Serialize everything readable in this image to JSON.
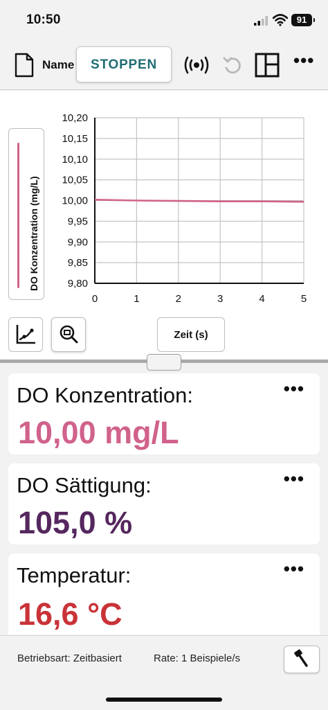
{
  "status_bar": {
    "time": "10:50",
    "battery": "91"
  },
  "toolbar": {
    "name_label": "Name",
    "stop_label": "STOPPEN",
    "icons": [
      "document-icon",
      "sensor-broadcast-icon",
      "undo-icon",
      "layout-icon",
      "more-icon"
    ]
  },
  "chart": {
    "ylabel": "DO Konzentration (mg/L)",
    "xlabel": "Zeit (s)",
    "tool_icons": [
      "graph-fit-icon",
      "zoom-fit-icon"
    ]
  },
  "chart_data": {
    "type": "line",
    "title": "",
    "xlabel": "Zeit (s)",
    "ylabel": "DO Konzentration (mg/L)",
    "xlim": [
      0,
      5
    ],
    "ylim": [
      9.8,
      10.2
    ],
    "x_ticks": [
      "0",
      "1",
      "2",
      "3",
      "4",
      "5"
    ],
    "y_ticks": [
      "10,20",
      "10,15",
      "10,10",
      "10,05",
      "10,00",
      "9,95",
      "9,90",
      "9,85",
      "9,80"
    ],
    "grid": true,
    "series": [
      {
        "color": "#d0628b",
        "x": [
          0,
          1,
          2,
          3,
          4,
          5
        ],
        "y": [
          10.002,
          10.0,
          9.999,
          9.998,
          9.998,
          9.997
        ]
      }
    ]
  },
  "meters": [
    {
      "label": "DO Konzentration:",
      "value": "10,00 mg/L",
      "color": "#d0628b"
    },
    {
      "label": "DO Sättigung:",
      "value": "105,0 %",
      "color": "#55275e"
    },
    {
      "label": "Temperatur:",
      "value": "16,6 °C",
      "color": "#c93338"
    }
  ],
  "footer": {
    "mode": "Betriebsart: Zeitbasiert",
    "rate": "Rate: 1 Beispiele/s"
  }
}
